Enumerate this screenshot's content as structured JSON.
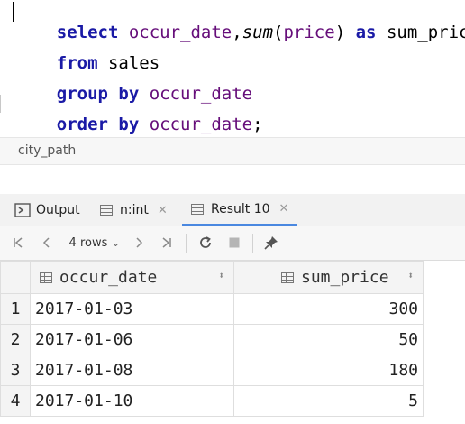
{
  "editor": {
    "line1": {
      "kw1": "select",
      "sp1": " ",
      "id1": "occur_date",
      "comma": ",",
      "fn": "sum",
      "paren_open": "(",
      "id2": "price",
      "paren_close": ")",
      "sp2": " ",
      "kw2": "as",
      "sp3": " ",
      "alias": "sum_price"
    },
    "line2": {
      "kw": "from",
      "sp": " ",
      "table": "sales"
    },
    "line3": {
      "kw": "group by",
      "sp": " ",
      "id": "occur_date"
    },
    "line4": {
      "kw": "order by",
      "sp": " ",
      "id": "occur_date",
      "semi": ";"
    }
  },
  "breadcrumb": {
    "path": "city_path"
  },
  "tabs": [
    {
      "label": "Output",
      "icon": "output-console-icon"
    },
    {
      "label": "n:int",
      "icon": "table-grid-icon",
      "close": "✕"
    },
    {
      "label": "Result 10",
      "icon": "table-grid-icon",
      "close": "✕",
      "active": true
    }
  ],
  "toolbar": {
    "first": "|<",
    "prev": "<",
    "rows_label": "4 rows",
    "rows_chevron": "⌄",
    "next": ">",
    "last": ">|",
    "reload": "⟳",
    "stop": "■",
    "pin": "📌"
  },
  "results": {
    "columns": [
      {
        "label": "occur_date",
        "sort": "⬍"
      },
      {
        "label": "sum_price",
        "sort": "⬍"
      }
    ],
    "rows": [
      {
        "num": "1",
        "date": "2017-01-03",
        "price": "300"
      },
      {
        "num": "2",
        "date": "2017-01-06",
        "price": "50"
      },
      {
        "num": "3",
        "date": "2017-01-08",
        "price": "180"
      },
      {
        "num": "4",
        "date": "2017-01-10",
        "price": "5"
      }
    ]
  },
  "colors": {
    "keyword": "#1a1aa6",
    "identifier": "#660e7a",
    "active_tab": "#4a88e0"
  }
}
